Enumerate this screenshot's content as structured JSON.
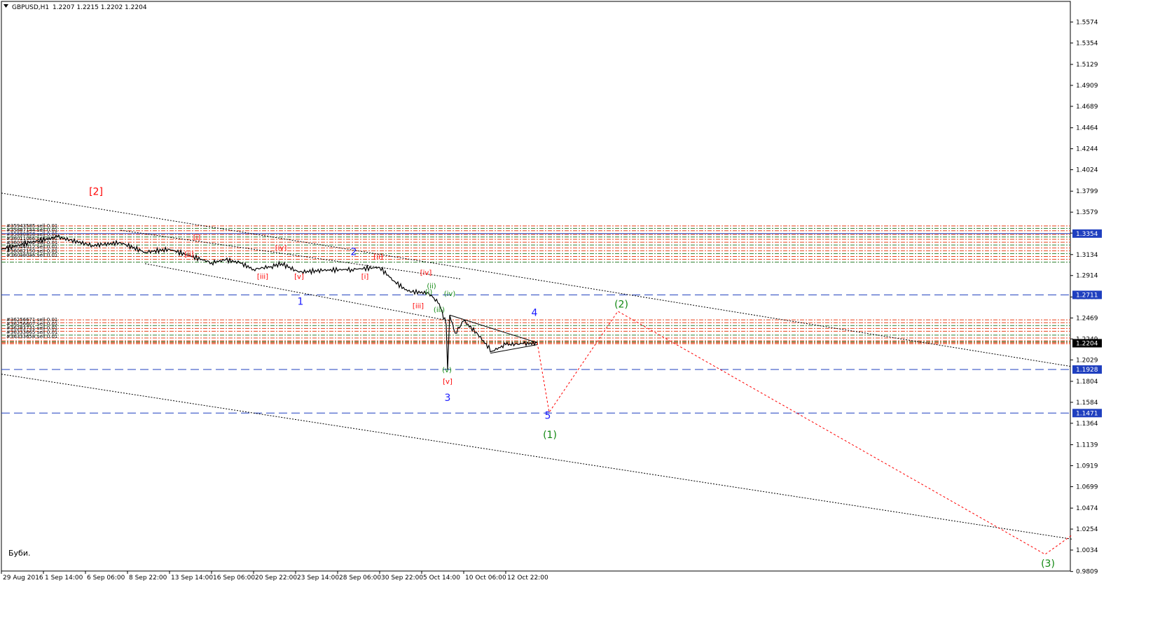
{
  "header": {
    "symbol": "GBPUSD,H1",
    "ohlc": "1.2207 1.2215 1.2202 1.2204",
    "menu_icon": "triangle-down-icon"
  },
  "note": "Буби.",
  "price_labels": [
    {
      "text": "1.3354",
      "value": 1.3354,
      "color": "#1f3fbf"
    },
    {
      "text": "1.2711",
      "value": 1.2711,
      "color": "#1f3fbf"
    },
    {
      "text": "1.2204",
      "value": 1.2204,
      "color": "#000000"
    },
    {
      "text": "1.1928",
      "value": 1.1928,
      "color": "#1f3fbf"
    },
    {
      "text": "1.1471",
      "value": 1.1471,
      "color": "#1f3fbf"
    }
  ],
  "chart_data": {
    "type": "line",
    "title": "GBPUSD,H1",
    "ylim": [
      0.9814,
      1.579
    ],
    "y_ticks": [
      "1.5574",
      "1.5354",
      "1.5129",
      "1.4909",
      "1.4689",
      "1.4464",
      "1.4244",
      "1.4024",
      "1.3799",
      "1.3579",
      "1.3359",
      "1.3134",
      "1.2914",
      "1.2689",
      "1.2469",
      "1.2249",
      "1.2029",
      "1.1804",
      "1.1584",
      "1.1364",
      "1.1139",
      "1.0919",
      "1.0699",
      "1.0474",
      "1.0254",
      "1.0034",
      "0.9809"
    ],
    "x_ticks": [
      "29 Aug 2016",
      "1 Sep 14:00",
      "6 Sep 06:00",
      "8 Sep 22:00",
      "13 Sep 14:00",
      "16 Sep 06:00",
      "20 Sep 22:00",
      "23 Sep 14:00",
      "28 Sep 06:00",
      "30 Sep 22:00",
      "5 Oct 14:00",
      "10 Oct 06:00",
      "12 Oct 22:00"
    ],
    "grid": false,
    "price_series": {
      "name": "GBPUSD",
      "t": [
        0,
        40,
        80,
        130,
        170,
        205,
        240,
        270,
        300,
        320,
        340,
        360,
        385,
        400,
        425,
        460,
        500,
        540,
        560,
        580,
        610,
        625,
        635,
        637,
        640,
        648,
        660,
        680,
        700,
        720,
        745,
        765
      ],
      "v": [
        1.3189,
        1.3259,
        1.3319,
        1.3229,
        1.3259,
        1.3159,
        1.3189,
        1.3119,
        1.3049,
        1.3079,
        1.3049,
        1.2979,
        1.3009,
        1.3039,
        1.2949,
        1.2969,
        1.2979,
        1.2999,
        1.2859,
        1.2749,
        1.2729,
        1.2619,
        1.2399,
        1.1928,
        1.2499,
        1.2309,
        1.2439,
        1.2299,
        1.2119,
        1.2189,
        1.2199,
        1.2204
      ]
    },
    "horizontal_levels": [
      {
        "value": 1.2711,
        "style": "dashed",
        "color": "#1f3fbf"
      },
      {
        "value": 1.1928,
        "style": "dashed",
        "color": "#1f3fbf"
      },
      {
        "value": 1.1471,
        "style": "dashed",
        "color": "#1f3fbf"
      },
      {
        "value": 1.3354,
        "style": "solid",
        "color": "#1f3fbf"
      }
    ],
    "order_levels_upper": [
      1.3434,
      1.3409,
      1.3384,
      1.3344,
      1.3319,
      1.3294,
      1.3264,
      1.3234,
      1.3204,
      1.3174,
      1.3144,
      1.3114,
      1.3084,
      1.3054
    ],
    "order_levels_lower": [
      1.2449,
      1.2419,
      1.2389,
      1.2359,
      1.2329,
      1.2289,
      1.2259,
      1.2229,
      1.2219,
      1.2209,
      1.2199
    ],
    "order_labels_upper": [
      "#35943585 sell 0.01",
      "#35887144 sell 0.01",
      "#35890858 sell 0.01",
      "#36011066 sell 0.01",
      "#36036262 sell 0.01",
      "#36044012 sell 0.01",
      "#36082150 sell 0.01",
      "#36048046 sell 0.01"
    ],
    "order_labels_lower": [
      "#36256671 sell 0.01",
      "#36256607 sell 0.01",
      "#36283731 sell 0.01",
      "#36333665 sell 0.01",
      "#36333658 sell 0.01"
    ],
    "wave_labels": [
      {
        "text": "[2]",
        "t": 135,
        "v": 1.3759,
        "color": "#ff0000"
      },
      {
        "text": "1",
        "t": 427,
        "v": 1.2609,
        "color": "#1a1aff"
      },
      {
        "text": "2",
        "t": 503,
        "v": 1.3129,
        "color": "#1a1aff"
      },
      {
        "text": "3",
        "t": 637,
        "v": 1.1599,
        "color": "#1a1aff"
      },
      {
        "text": "4",
        "t": 761,
        "v": 1.2489,
        "color": "#1a1aff"
      },
      {
        "text": "5",
        "t": 780,
        "v": 1.1409,
        "color": "#1a1aff"
      },
      {
        "text": "(1)",
        "t": 783,
        "v": 1.1209,
        "color": "#118811"
      },
      {
        "text": "(2)",
        "t": 885,
        "v": 1.2579,
        "color": "#118811"
      },
      {
        "text": "(3)",
        "t": 1494,
        "v": 0.9859,
        "color": "#118811"
      },
      {
        "text": "[i]",
        "t": 279,
        "v": 1.3289,
        "color": "#ff0000"
      },
      {
        "text": "[ii]",
        "t": 268,
        "v": 1.3109,
        "color": "#ff0000"
      },
      {
        "text": "[iii]",
        "t": 373,
        "v": 1.2879,
        "color": "#ff0000"
      },
      {
        "text": "[iv]",
        "t": 399,
        "v": 1.3179,
        "color": "#ff0000"
      },
      {
        "text": "[v]",
        "t": 425,
        "v": 1.2879,
        "color": "#ff0000"
      },
      {
        "text": "[i]",
        "t": 519,
        "v": 1.2879,
        "color": "#ff0000"
      },
      {
        "text": "[ii]",
        "t": 538,
        "v": 1.3089,
        "color": "#ff0000"
      },
      {
        "text": "[iii]",
        "t": 595,
        "v": 1.2569,
        "color": "#ff0000"
      },
      {
        "text": "[iv]",
        "t": 606,
        "v": 1.2919,
        "color": "#ff0000"
      },
      {
        "text": "[v]",
        "t": 637,
        "v": 1.1779,
        "color": "#ff0000"
      },
      {
        "text": "(i)",
        "t": 610,
        "v": 1.2719,
        "color": "#118811"
      },
      {
        "text": "(ii)",
        "t": 614,
        "v": 1.2779,
        "color": "#118811"
      },
      {
        "text": "(iii)",
        "t": 625,
        "v": 1.2529,
        "color": "#118811"
      },
      {
        "text": "(iv)",
        "t": 640,
        "v": 1.2699,
        "color": "#118811"
      },
      {
        "text": "(v)",
        "t": 636,
        "v": 1.1899,
        "color": "#118811"
      }
    ],
    "trend_lines": [
      {
        "t1": 0,
        "v1": 1.3779,
        "t2": 1528,
        "v2": 1.1959,
        "style": "dotted"
      },
      {
        "t1": 0,
        "v1": 1.1879,
        "t2": 1528,
        "v2": 1.0149,
        "style": "dotted"
      },
      {
        "t1": 170,
        "v1": 1.3389,
        "t2": 655,
        "v2": 1.2879,
        "style": "dotted"
      },
      {
        "t1": 205,
        "v1": 1.3039,
        "t2": 640,
        "v2": 1.2439,
        "style": "dotted"
      },
      {
        "t1": 640,
        "v1": 1.2499,
        "t2": 765,
        "v2": 1.2209,
        "style": "solid"
      },
      {
        "t1": 698,
        "v1": 1.2099,
        "t2": 765,
        "v2": 1.2189,
        "style": "solid"
      }
    ],
    "projection": {
      "t": [
        765,
        782,
        880,
        1490,
        1528
      ],
      "v": [
        1.2209,
        1.1479,
        1.2539,
        0.9989,
        1.0189
      ],
      "color": "#ff0000",
      "style": "dotted"
    }
  }
}
